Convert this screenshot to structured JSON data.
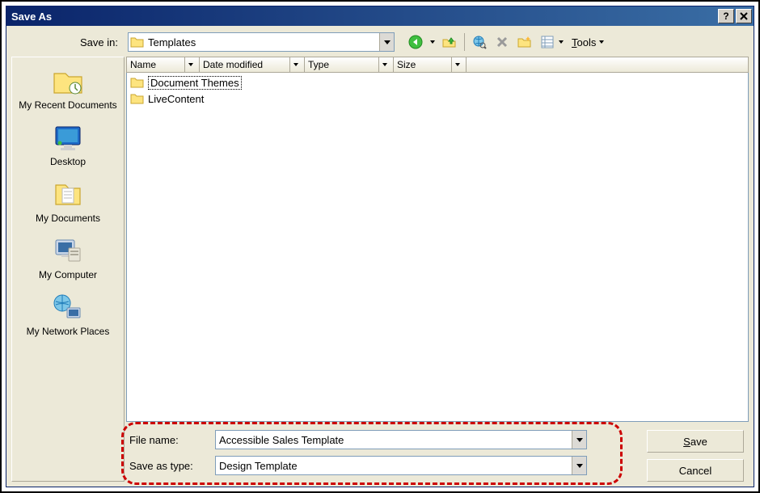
{
  "title": "Save As",
  "save_in": {
    "label": "Save in:",
    "value": "Templates"
  },
  "toolbar": {
    "tools_label": "Tools"
  },
  "places": [
    {
      "label": "My Recent Documents"
    },
    {
      "label": "Desktop"
    },
    {
      "label": "My Documents"
    },
    {
      "label": "My Computer"
    },
    {
      "label": "My Network Places"
    }
  ],
  "columns": [
    "Name",
    "Date modified",
    "Type",
    "Size"
  ],
  "files": [
    {
      "name": "Document Themes",
      "type": "folder",
      "selected": true
    },
    {
      "name": "LiveContent",
      "type": "folder",
      "selected": false
    }
  ],
  "file_name": {
    "label": "File name:",
    "value": "Accessible Sales Template"
  },
  "save_as_type": {
    "label": "Save as type:",
    "value": "Design Template"
  },
  "buttons": {
    "save": "Save",
    "cancel": "Cancel"
  }
}
